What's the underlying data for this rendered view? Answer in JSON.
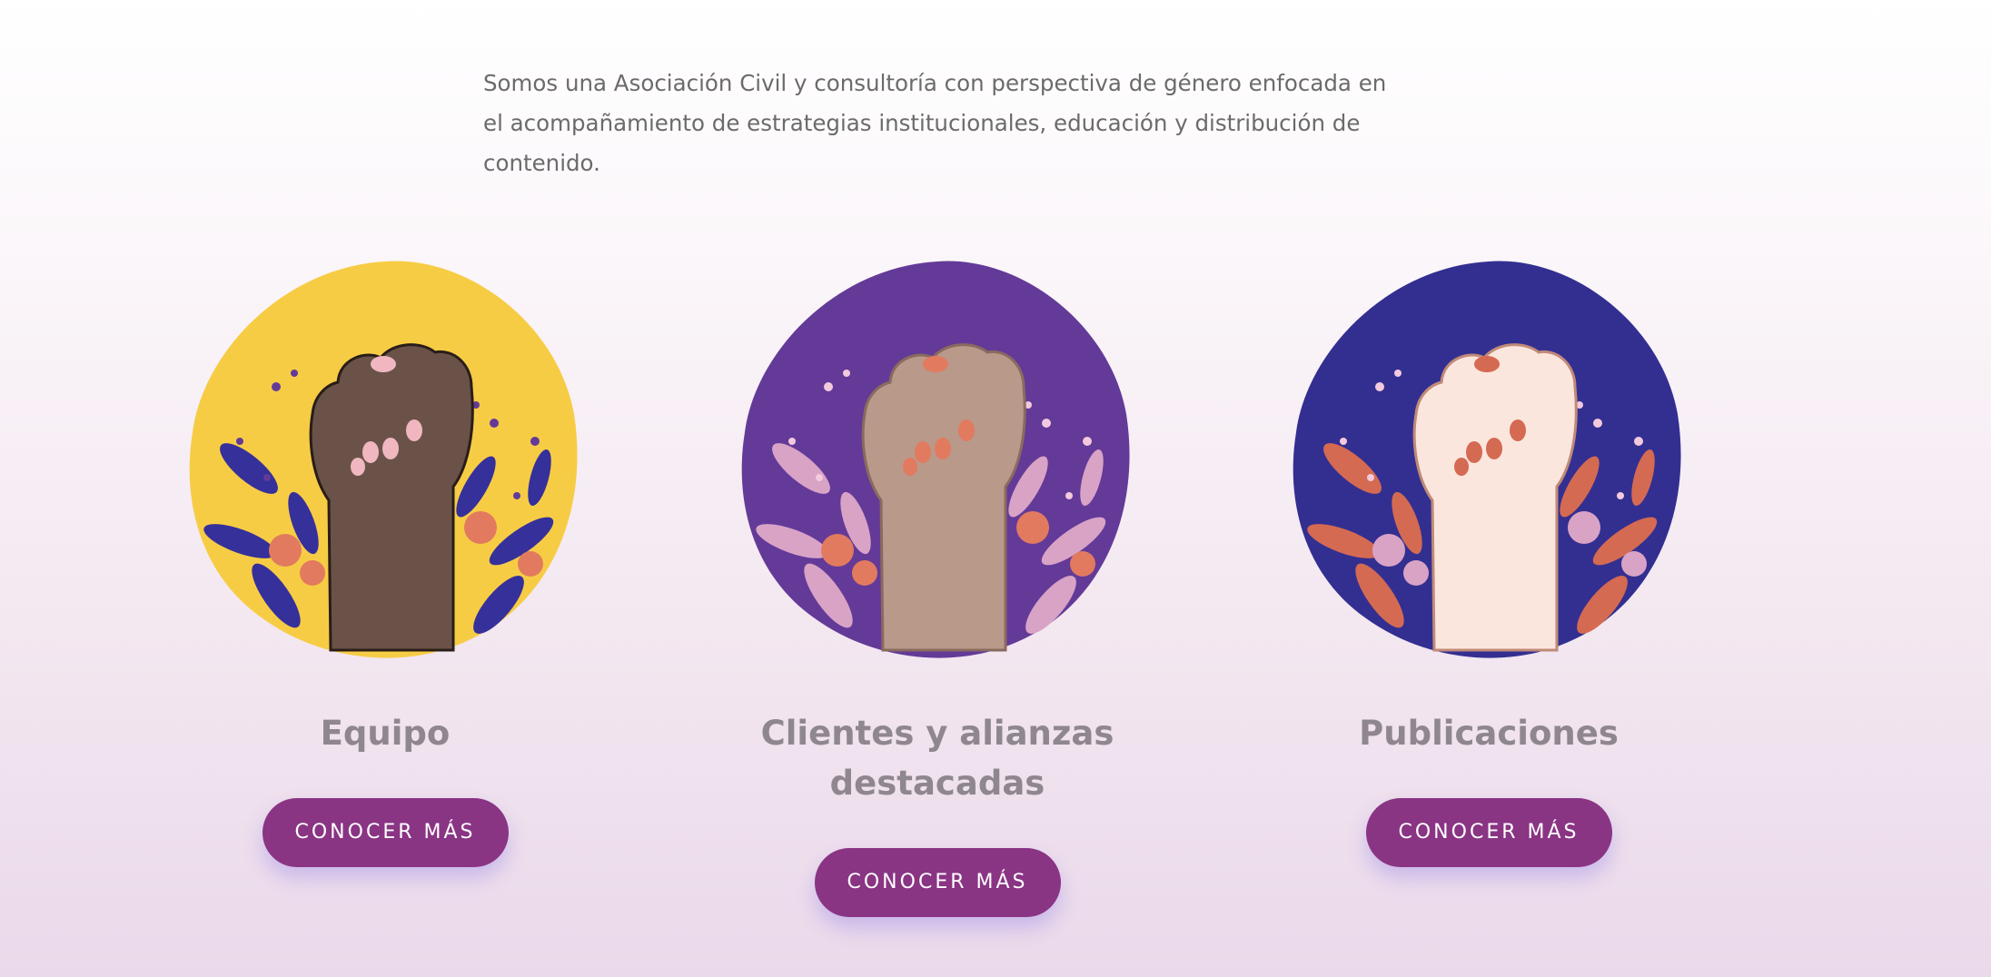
{
  "intro_text": "Somos una Asociación Civil y consultoría con perspectiva de género enfocada en el acompañamiento de estrategias institucionales, educación y distribución de contenido.",
  "cards": [
    {
      "title": "Equipo",
      "button_label": "CONOCER MÁS",
      "illustration": "raised-fist-icon",
      "bg_color": "#f7cc45",
      "skin_color": "#6a5249",
      "leaf_color": "#35309a",
      "flower_color": "#e27a5f"
    },
    {
      "title": "Clientes y alianzas destacadas",
      "button_label": "CONOCER MÁS",
      "illustration": "raised-fist-icon",
      "bg_color": "#633a98",
      "skin_color": "#b9998a",
      "leaf_color": "#d9a3c6",
      "flower_color": "#e27a5f"
    },
    {
      "title": "Publicaciones",
      "button_label": "CONOCER MÁS",
      "illustration": "raised-fist-icon",
      "bg_color": "#332f91",
      "skin_color": "#fbe6dd",
      "leaf_color": "#d56a52",
      "flower_color": "#d9a3c6"
    }
  ],
  "colors": {
    "button_bg": "#8a3484",
    "heading_text": "#8f8790",
    "body_text": "#6b6b6b"
  }
}
